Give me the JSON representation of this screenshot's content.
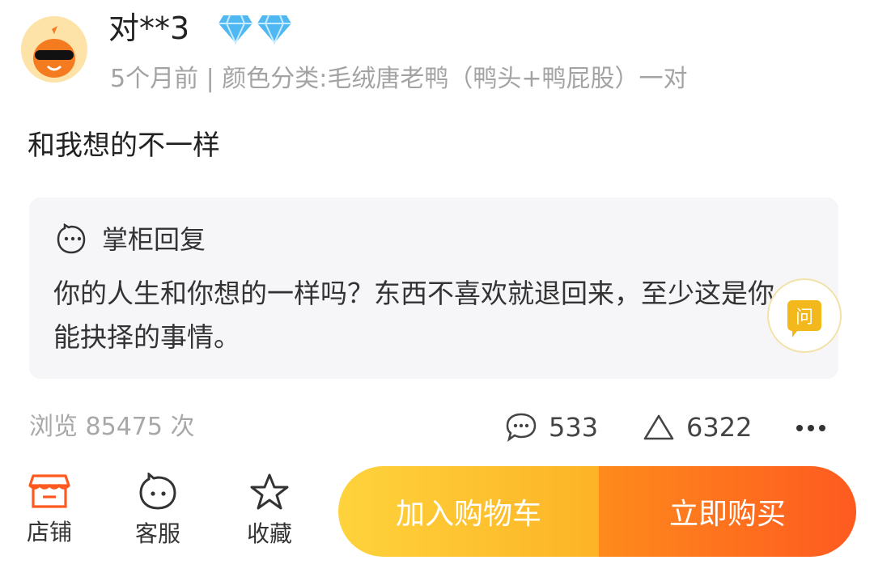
{
  "review": {
    "username": "对**3",
    "meta": "5个月前 | 颜色分类:毛绒唐老鸭（鸭头+鸭屁股）一对",
    "content": "和我想的不一样"
  },
  "reply": {
    "title": "掌柜回复",
    "text": "你的人生和你想的一样吗？东西不喜欢就退回来，至少这是你能抉择的事情。",
    "ask_label": "问"
  },
  "stats": {
    "views": "浏览 85475 次",
    "comments": "533",
    "likes": "6322"
  },
  "bottom_bar": {
    "shop": "店铺",
    "service": "客服",
    "favorite": "收藏",
    "add_to_cart": "加入购物车",
    "buy_now": "立即购买"
  },
  "colors": {
    "cart_button": "#fdbf2d",
    "buy_button": "#fe6a1f",
    "shop_icon": "#fe5a20",
    "diamond": "#4fb7f2"
  },
  "icons": [
    "avatar",
    "diamond-icon",
    "smile-chat-icon",
    "ask-icon",
    "comment-icon",
    "like-icon",
    "more-icon",
    "shop-icon",
    "service-icon",
    "star-icon"
  ]
}
